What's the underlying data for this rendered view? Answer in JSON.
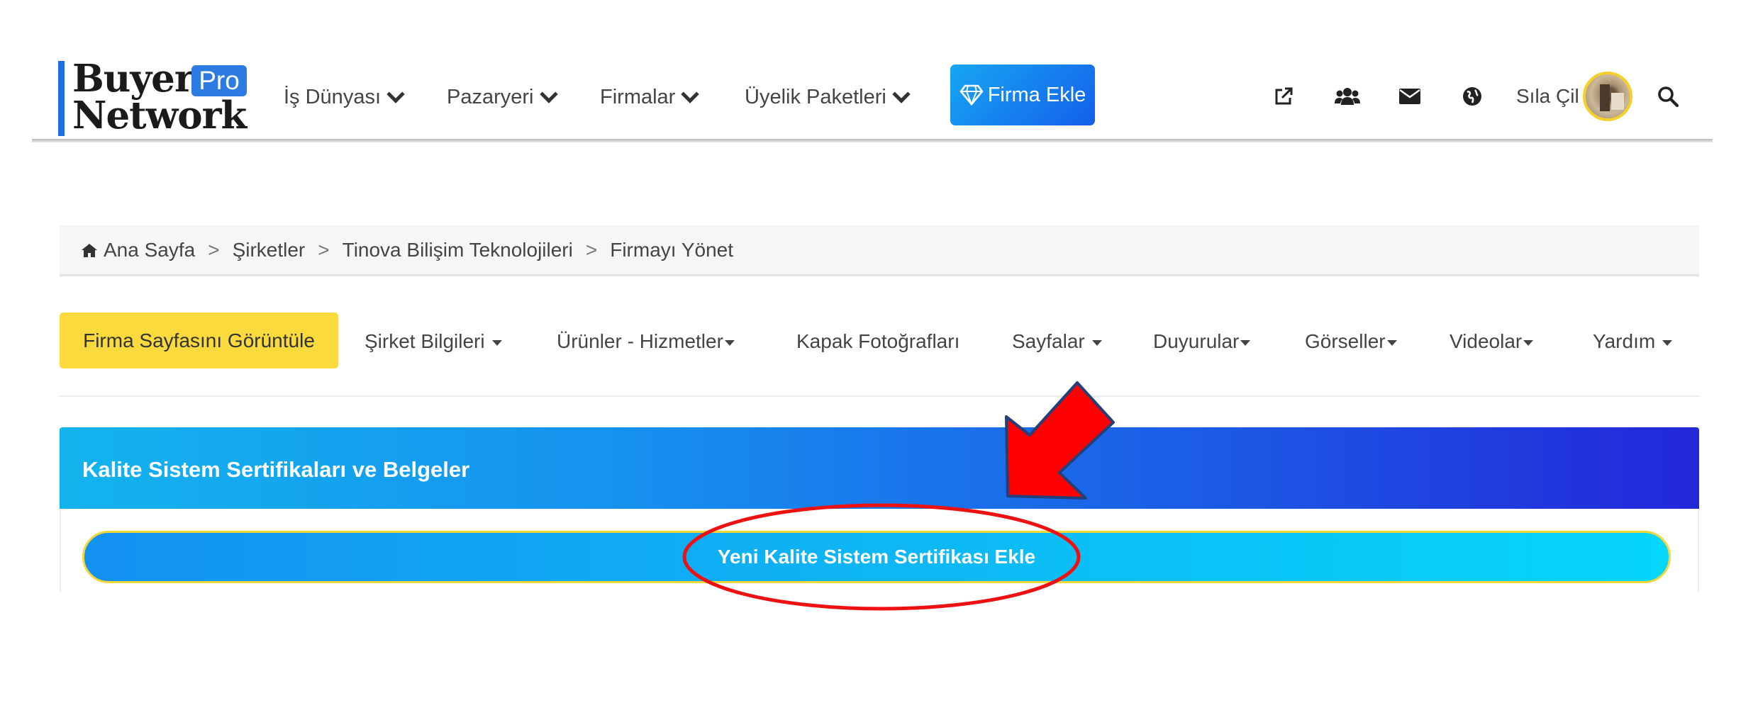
{
  "header": {
    "logo": {
      "line1": "Buyer",
      "line2": "Network",
      "badge": "Pro"
    },
    "nav": [
      {
        "label": "İş Dünyası"
      },
      {
        "label": "Pazaryeri"
      },
      {
        "label": "Firmalar"
      },
      {
        "label": "Üyelik Paketleri"
      }
    ],
    "cta_label": "Firma Ekle",
    "icons": [
      "external-link-icon",
      "users-icon",
      "envelope-icon",
      "globe-icon"
    ],
    "user_name": "Sıla Çil",
    "search_icon": "search-icon"
  },
  "breadcrumb": {
    "items": [
      "Ana Sayfa",
      "Şirketler",
      "Tinova Bilişim Teknolojileri",
      "Firmayı Yönet"
    ],
    "separator": ">"
  },
  "subnav": {
    "view_button": "Firma Sayfasını Görüntüle",
    "tabs": [
      "Şirket Bilgileri",
      "Ürünler - Hizmetler",
      "Kapak Fotoğrafları",
      "Sayfalar",
      "Duyurular",
      "Görseller",
      "Videolar",
      "Yardım"
    ]
  },
  "panel": {
    "title": "Kalite Sistem Sertifikaları ve Belgeler",
    "add_button": "Yeni Kalite Sistem Sertifikası Ekle"
  },
  "colors": {
    "brand_blue": "#1f6fe0",
    "cta_yellow": "#fbda3d",
    "annotation_red": "#ff0000"
  }
}
